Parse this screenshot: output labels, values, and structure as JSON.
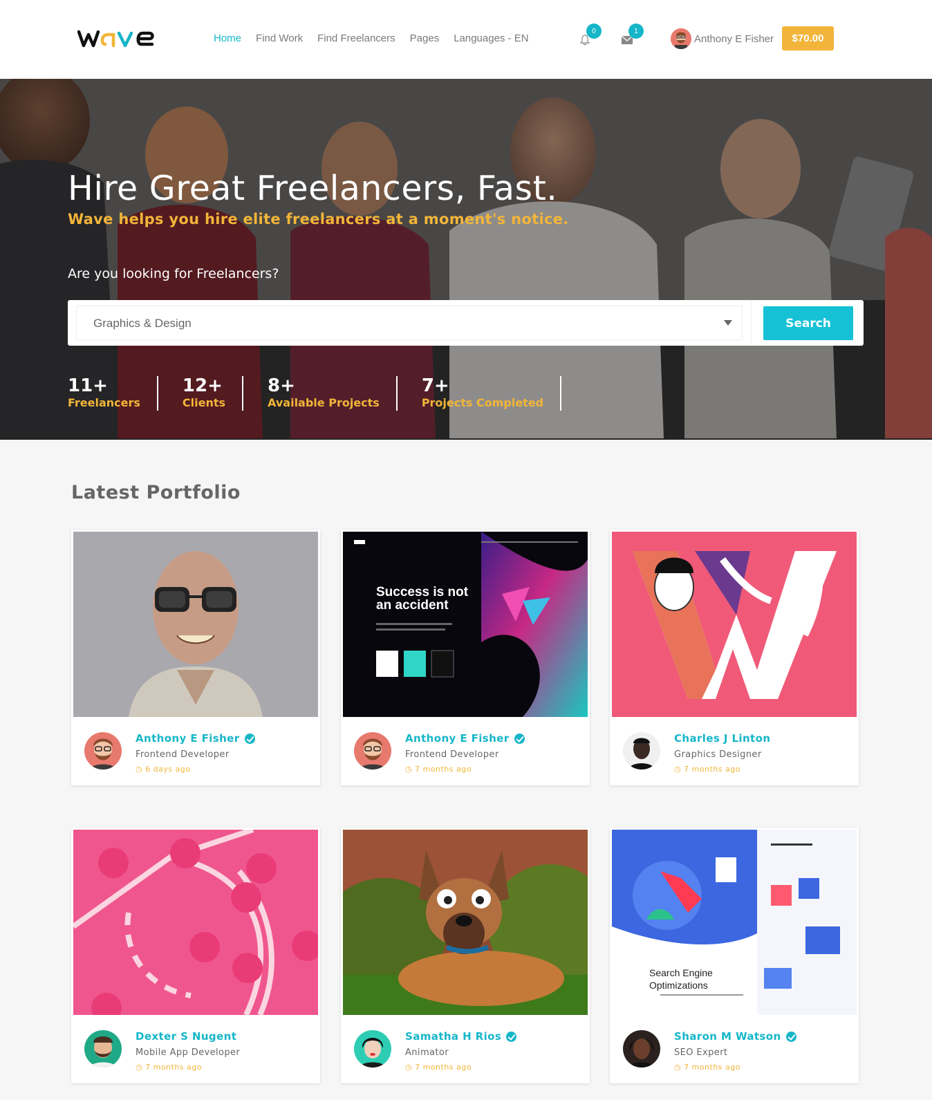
{
  "header": {
    "logo_text": "wave",
    "nav": [
      "Home",
      "Find Work",
      "Find Freelancers",
      "Pages",
      "Languages - EN"
    ],
    "notifications_count": "0",
    "messages_count": "1",
    "user_name": "Anthony E Fisher",
    "balance": "$70.00",
    "icons": {
      "notifications": "bell-icon",
      "messages": "envelope-icon"
    }
  },
  "hero": {
    "title": "Hire Great Freelancers, Fast.",
    "subtitle": "Wave helps you hire elite freelancers at a moment's notice.",
    "question": "Are you looking for Freelancers?",
    "search": {
      "selected": "Graphics & Design",
      "button": "Search"
    },
    "stats": [
      {
        "num": "11+",
        "label": "Freelancers"
      },
      {
        "num": "12+",
        "label": "Clients"
      },
      {
        "num": "8+",
        "label": "Available Projects"
      },
      {
        "num": "7+",
        "label": "Projects Completed"
      }
    ]
  },
  "portfolio": {
    "title": "Latest Portfolio",
    "cards": [
      {
        "name": "Anthony E Fisher",
        "verified": true,
        "role": "Frontend Developer",
        "time": "6 days ago"
      },
      {
        "name": "Anthony E Fisher",
        "verified": true,
        "role": "Frontend Developer",
        "time": "7 months ago"
      },
      {
        "name": "Charles J Linton",
        "verified": false,
        "role": "Graphics Designer",
        "time": "7 months ago"
      },
      {
        "name": "Dexter S Nugent",
        "verified": false,
        "role": "Mobile App Developer",
        "time": "7 months ago"
      },
      {
        "name": "Samatha H Rios",
        "verified": true,
        "role": "Animator",
        "time": "7 months ago"
      },
      {
        "name": "Sharon M Watson",
        "verified": true,
        "role": "SEO Expert",
        "time": "7 months ago"
      }
    ],
    "card2_image_text": {
      "headline": "Success is not an accident"
    },
    "card6_image_text": {
      "headline": "Search Engine Optimizations"
    }
  },
  "colors": {
    "accent": "#16b6c9",
    "gold": "#f2b539"
  }
}
